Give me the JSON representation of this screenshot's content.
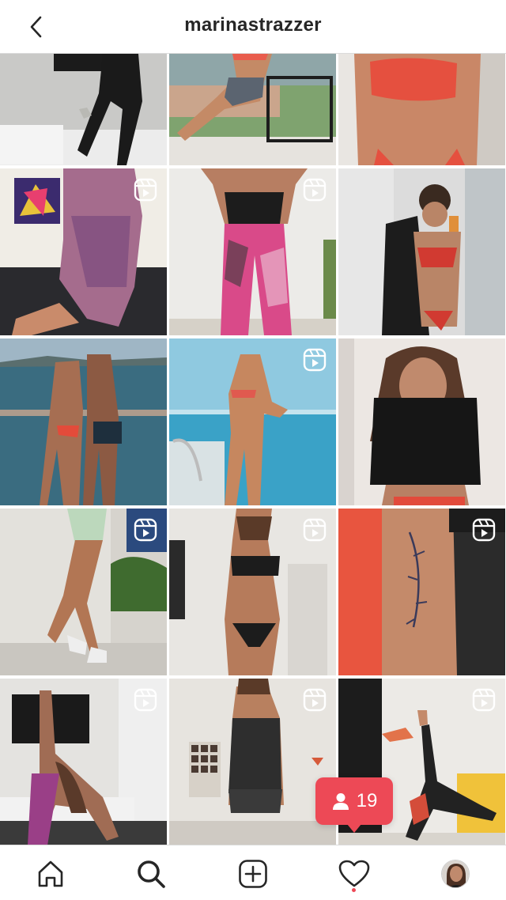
{
  "header": {
    "username": "marinastrazzer",
    "back_icon": "chevron-left-icon"
  },
  "grid": {
    "posts": [
      {
        "kind": "photo",
        "reel": false
      },
      {
        "kind": "photo",
        "reel": false
      },
      {
        "kind": "photo",
        "reel": false
      },
      {
        "kind": "reel",
        "reel": true
      },
      {
        "kind": "reel",
        "reel": true
      },
      {
        "kind": "photo",
        "reel": false
      },
      {
        "kind": "photo",
        "reel": false
      },
      {
        "kind": "reel",
        "reel": true
      },
      {
        "kind": "photo",
        "reel": false
      },
      {
        "kind": "reel",
        "reel": true
      },
      {
        "kind": "reel",
        "reel": true
      },
      {
        "kind": "reel",
        "reel": true
      },
      {
        "kind": "reel",
        "reel": true
      },
      {
        "kind": "reel",
        "reel": true
      },
      {
        "kind": "reel",
        "reel": true
      }
    ]
  },
  "notification": {
    "icon": "person-icon",
    "count": "19",
    "color": "#ed4956"
  },
  "tabbar": {
    "items": [
      {
        "icon": "home-icon"
      },
      {
        "icon": "search-icon",
        "active": true
      },
      {
        "icon": "new-post-icon"
      },
      {
        "icon": "heart-icon",
        "has_dot": true
      },
      {
        "icon": "profile-avatar"
      }
    ]
  },
  "colors": {
    "accent": "#ed4956",
    "divider": "#dbdbdb",
    "text": "#262626"
  }
}
